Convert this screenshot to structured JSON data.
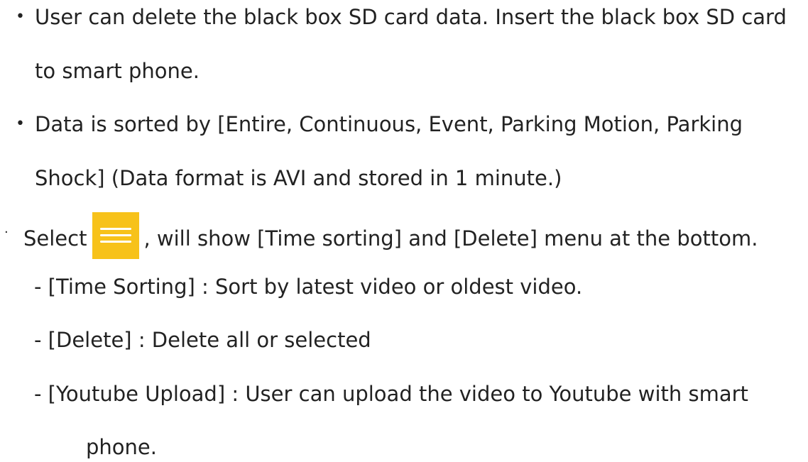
{
  "bullets": {
    "b1_marker": "•",
    "b1_line1": "User can delete the black box SD card data. Insert the black box SD card",
    "b1_line2": "to smart phone.",
    "b2_marker": "•",
    "b2_line1": "Data is sorted by [Entire, Continuous, Event, Parking Motion, Parking",
    "b2_line2": "Shock] (Data format is AVI and stored in 1 minute.)"
  },
  "select_line": {
    "marker": ".",
    "before": "Select",
    "after": ", will show [Time sorting] and [Delete] menu at the bottom.",
    "icon": "menu-icon",
    "icon_color": "#f7c21a"
  },
  "sub_items": {
    "time_sorting": "- [Time Sorting] : Sort by latest video or oldest video.",
    "delete": "- [Delete] : Delete all or selected",
    "youtube_line1": "- [Youtube Upload] : User can upload the video to Youtube with smart",
    "youtube_line2": "phone."
  }
}
